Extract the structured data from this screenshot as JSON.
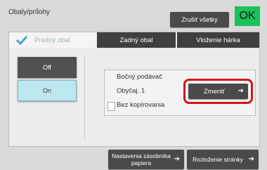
{
  "header": {
    "title": "Obaly/prílohy",
    "clear_all": "Zrušiť všetky",
    "ok": "OK"
  },
  "tabs": [
    {
      "label": "Predný obal",
      "active": true
    },
    {
      "label": "Zadný obal",
      "active": false
    },
    {
      "label": "Vloženie hárka",
      "active": false
    }
  ],
  "toggle": {
    "off": "Off",
    "on": "On",
    "selected": "On"
  },
  "info": {
    "line1": "Bočný podávač",
    "line2": "Obyčaj. 1",
    "line3": "Bez kopírovania"
  },
  "change_button": "Zmeniť",
  "bottom": {
    "tray_settings": "Nastavenia zásobníka papiera",
    "page_layout": "Rozloženie stránky"
  },
  "icons": {
    "check": "check-icon",
    "arrow": "arrow-right-icon",
    "copy": "blank-page-icon"
  },
  "colors": {
    "ok": "#19c25b",
    "highlight": "#d4161c",
    "selected": "#bde7ef"
  }
}
